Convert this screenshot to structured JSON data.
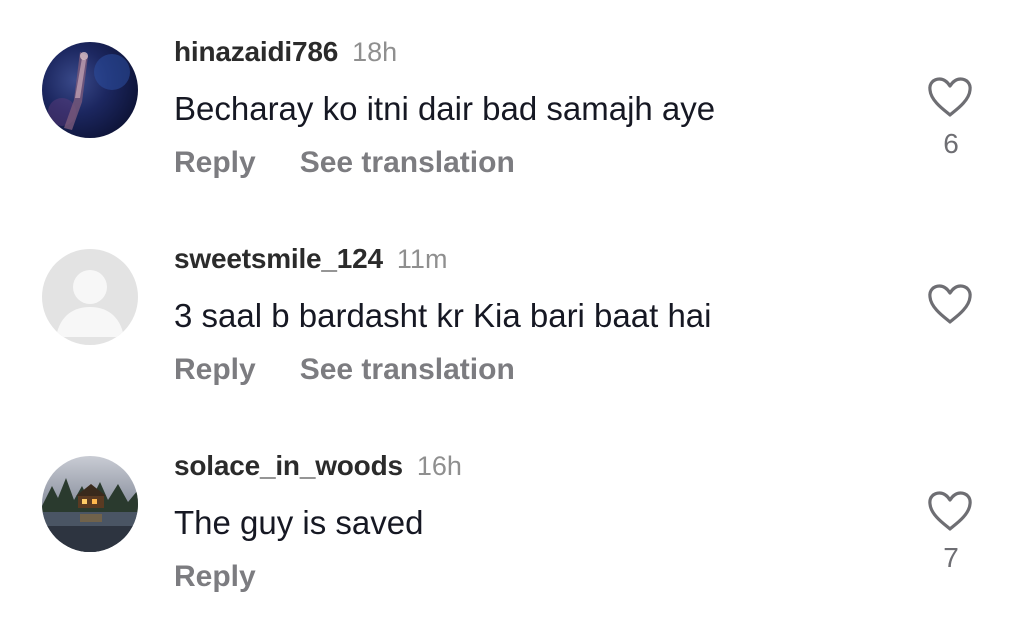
{
  "comments": [
    {
      "username": "hinazaidi786",
      "time": "18h",
      "text": "Becharay ko itni dair bad samajh aye",
      "reply_label": "Reply",
      "translation_label": "See translation",
      "likes": "6",
      "avatar": "dark-blue-photo"
    },
    {
      "username": "sweetsmile_124",
      "time": "11m",
      "text": "3 saal b bardasht kr Kia bari baat hai",
      "reply_label": "Reply",
      "translation_label": "See translation",
      "likes": "",
      "avatar": "default-profile-icon"
    },
    {
      "username": "solace_in_woods",
      "time": "16h",
      "text": "The guy is saved",
      "reply_label": "Reply",
      "translation_label": "",
      "likes": "7",
      "avatar": "cabin-lake-photo"
    }
  ],
  "colors": {
    "username": "#2b2b2b",
    "time": "#8f8f8f",
    "text": "#161823",
    "action": "#7c7c80",
    "heart": "#6e6e73"
  },
  "icons": {
    "like": "heart-outline-icon"
  }
}
